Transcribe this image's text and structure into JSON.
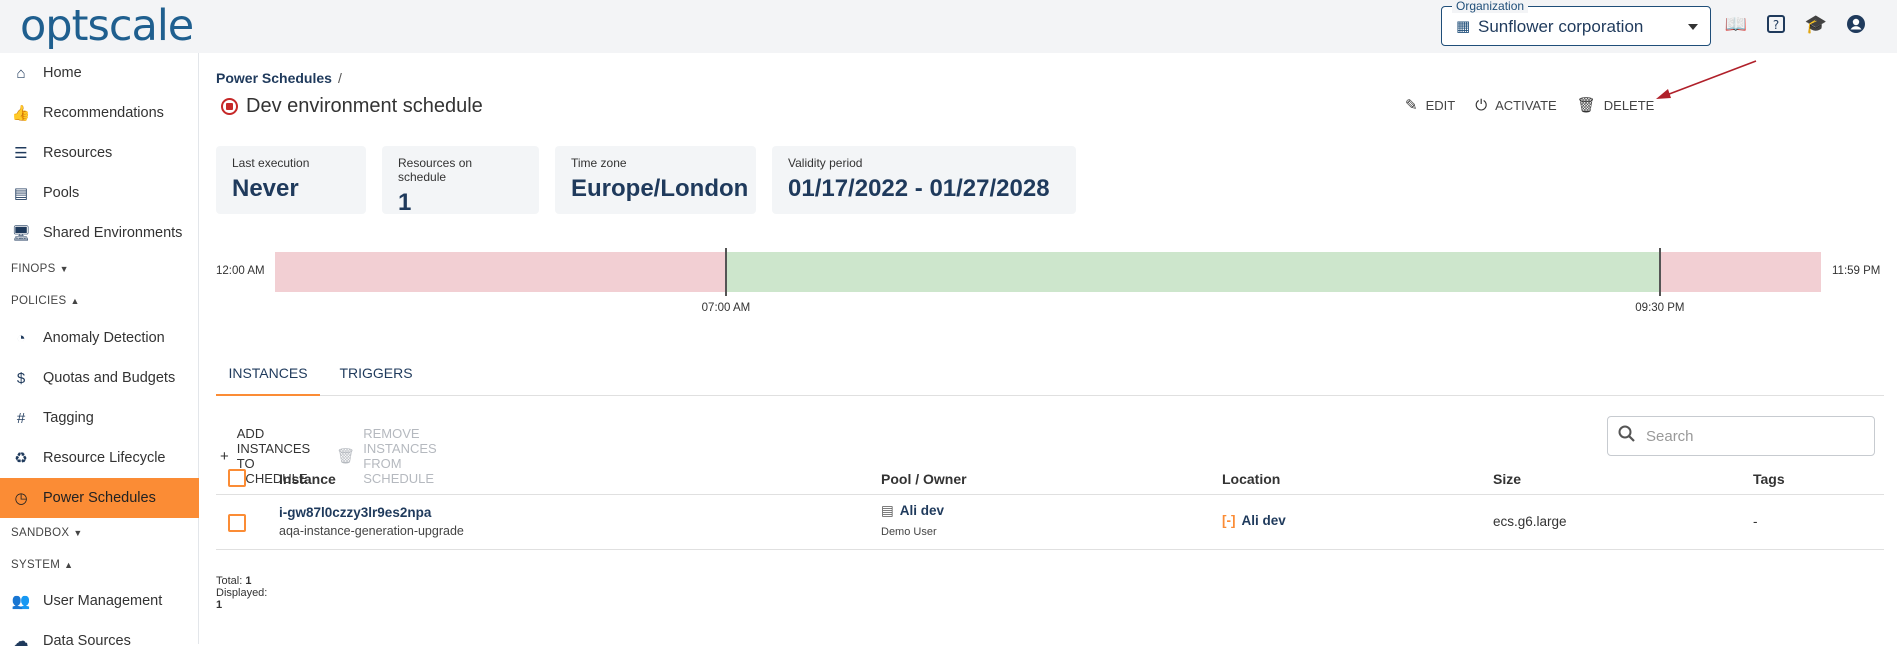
{
  "app": {
    "logo": "optscale",
    "organization_label": "Organization",
    "organization_value": "Sunflower corporation"
  },
  "sidebar": {
    "items": [
      {
        "label": "Home",
        "icon": "home-icon"
      },
      {
        "label": "Recommendations",
        "icon": "thumbs-up-icon"
      },
      {
        "label": "Resources",
        "icon": "list-icon"
      },
      {
        "label": "Pools",
        "icon": "pool-icon"
      },
      {
        "label": "Shared Environments",
        "icon": "monitor-icon"
      },
      {
        "label": "Anomaly Detection",
        "icon": "anomaly-icon"
      },
      {
        "label": "Quotas and Budgets",
        "icon": "dollar-cycle-icon"
      },
      {
        "label": "Tagging",
        "icon": "hashtag-icon"
      },
      {
        "label": "Resource Lifecycle",
        "icon": "lifecycle-icon"
      },
      {
        "label": "Power Schedules",
        "icon": "clock-icon"
      },
      {
        "label": "User Management",
        "icon": "users-icon"
      },
      {
        "label": "Data Sources",
        "icon": "cloud-icon"
      }
    ],
    "sections": {
      "finops": "FINOPS",
      "policies": "POLICIES",
      "sandbox": "SANDBOX",
      "system": "SYSTEM"
    }
  },
  "page": {
    "breadcrumb": "Power Schedules",
    "breadcrumb_sep": "/",
    "title": "Dev environment schedule",
    "actions": {
      "edit": "EDIT",
      "activate": "ACTIVATE",
      "delete": "DELETE"
    }
  },
  "cards": [
    {
      "label": "Last execution",
      "value": "Never"
    },
    {
      "label": "Resources on schedule",
      "value": "1"
    },
    {
      "label": "Time zone",
      "value": "Europe/London"
    },
    {
      "label": "Validity period",
      "value": "01/17/2022 - 01/27/2028"
    }
  ],
  "timeline": {
    "start_label": "12:00 AM",
    "end_label": "11:59 PM",
    "on_label": "07:00 AM",
    "off_label": "09:30 PM",
    "on_fraction": 0.2917,
    "off_fraction": 0.8958,
    "colors": {
      "off": "#f2cfd3",
      "on": "#cde6cc"
    }
  },
  "tabs": {
    "instances": "INSTANCES",
    "triggers": "TRIGGERS"
  },
  "table_actions": {
    "add": "ADD INSTANCES TO SCHEDULE",
    "remove": "REMOVE INSTANCES FROM SCHEDULE",
    "search_placeholder": "Search"
  },
  "table": {
    "columns": [
      "Instance",
      "Pool / Owner",
      "Location",
      "Size",
      "Tags"
    ],
    "rows": [
      {
        "instance_id": "i-gw87l0czzy3lr9es2npa",
        "instance_name": "aqa-instance-generation-upgrade",
        "pool": "Ali dev",
        "owner": "Demo User",
        "location": "Ali dev",
        "size": "ecs.g6.large",
        "tags": "-"
      }
    ]
  },
  "footer": {
    "total_label": "Total:",
    "total": "1",
    "displayed_label": "Displayed:",
    "displayed": "1"
  },
  "colors": {
    "accent": "#fb8c35",
    "primary": "#1f3a5c",
    "alert": "#c62828"
  }
}
